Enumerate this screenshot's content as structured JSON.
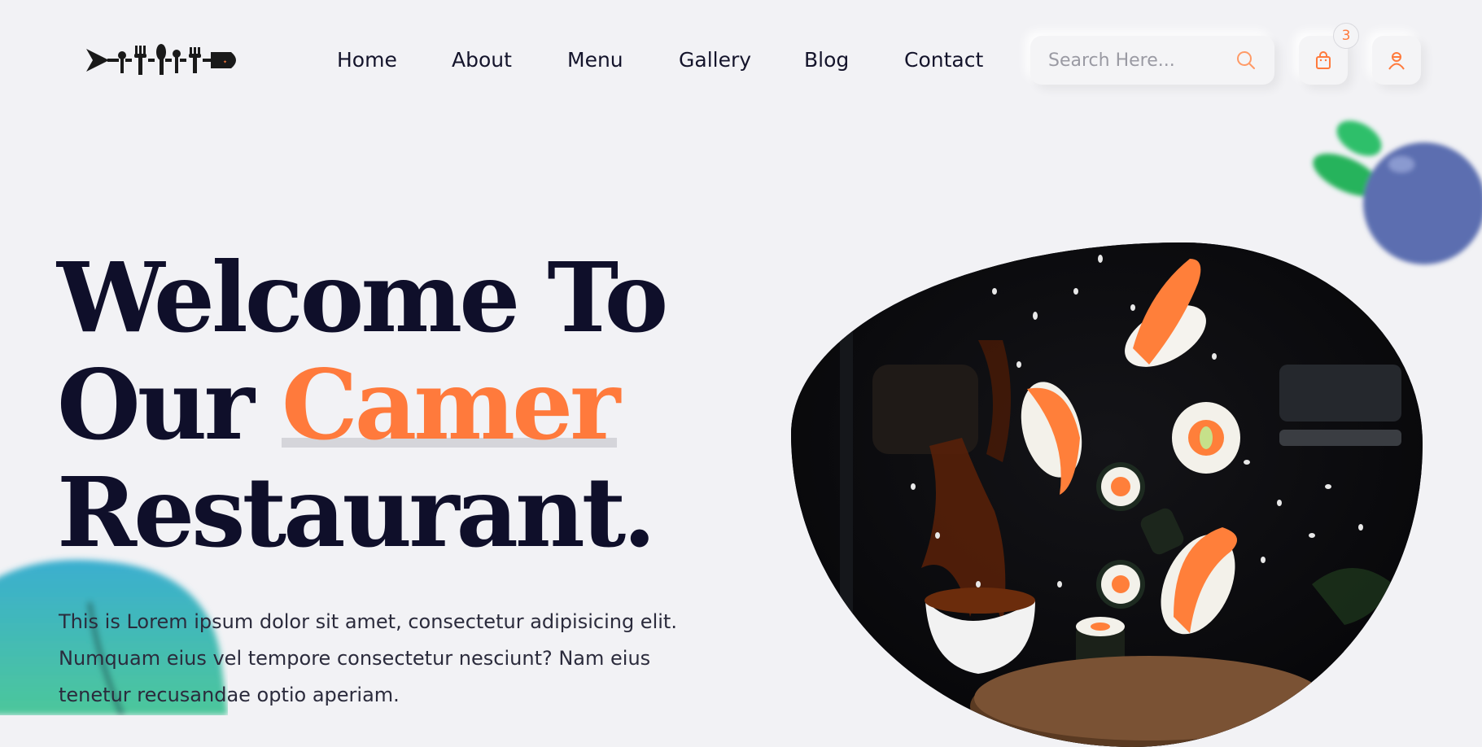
{
  "nav": {
    "items": [
      "Home",
      "About",
      "Menu",
      "Gallery",
      "Blog",
      "Contact"
    ]
  },
  "search": {
    "placeholder": "Search Here..."
  },
  "cart": {
    "count": "3"
  },
  "hero": {
    "line1": "Welcome To",
    "line2_prefix": "Our ",
    "line2_accent": "Camer",
    "line3": "Restaurant.",
    "description": "This is Lorem ipsum dolor sit amet, consectetur adipisicing elit. Numquam eius vel tempore consectetur nesciunt? Nam eius tenetur recusandae optio aperiam."
  },
  "icons": {
    "logo": "cutlery-fish-logo",
    "search": "search-icon",
    "cart": "shopping-bag-icon",
    "user": "user-icon"
  },
  "colors": {
    "accent": "#ff7a3c",
    "heading": "#0f0f2a",
    "background": "#f2f2f5"
  }
}
